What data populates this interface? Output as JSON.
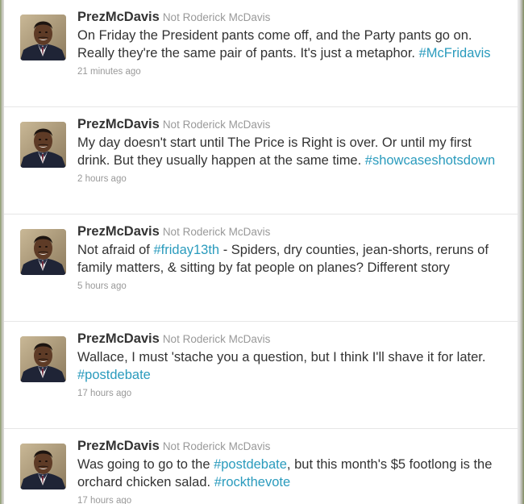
{
  "tweets": [
    {
      "screen_name": "PrezMcDavis",
      "full_name": "Not Roderick McDavis",
      "parts": [
        {
          "text": "On Friday the President pants come off, and the Party pants go on. Really they're the same pair of pants. It's just a metaphor. ",
          "tag": false
        },
        {
          "text": "#McFridavis",
          "tag": true
        }
      ],
      "time": "21 minutes ago"
    },
    {
      "screen_name": "PrezMcDavis",
      "full_name": "Not Roderick McDavis",
      "parts": [
        {
          "text": "My day doesn't start until The Price is Right is over. Or until my first drink. But they usually happen at the same time. ",
          "tag": false
        },
        {
          "text": "#showcaseshotsdown",
          "tag": true
        }
      ],
      "time": "2 hours ago"
    },
    {
      "screen_name": "PrezMcDavis",
      "full_name": "Not Roderick McDavis",
      "parts": [
        {
          "text": "Not afraid of ",
          "tag": false
        },
        {
          "text": "#friday13th",
          "tag": true
        },
        {
          "text": " - Spiders, dry counties, jean-shorts, reruns of family matters, & sitting by fat people on planes? Different story",
          "tag": false
        }
      ],
      "time": "5 hours ago"
    },
    {
      "screen_name": "PrezMcDavis",
      "full_name": "Not Roderick McDavis",
      "parts": [
        {
          "text": "Wallace, I must 'stache you a question, but I think I'll shave it for later. ",
          "tag": false
        },
        {
          "text": "#postdebate",
          "tag": true
        }
      ],
      "time": "17 hours ago"
    },
    {
      "screen_name": "PrezMcDavis",
      "full_name": "Not Roderick McDavis",
      "parts": [
        {
          "text": "Was going to go to the ",
          "tag": false
        },
        {
          "text": "#postdebate",
          "tag": true
        },
        {
          "text": ", but this month's $5 footlong is the orchard chicken salad. ",
          "tag": false
        },
        {
          "text": "#rockthevote",
          "tag": true
        }
      ],
      "time": "17 hours ago"
    }
  ],
  "colors": {
    "text": "#333333",
    "meta": "#999999",
    "hashtag": "#2a9bbd",
    "divider": "#e6e6e6"
  },
  "icons": {
    "avatar": "profile-photo-icon"
  }
}
